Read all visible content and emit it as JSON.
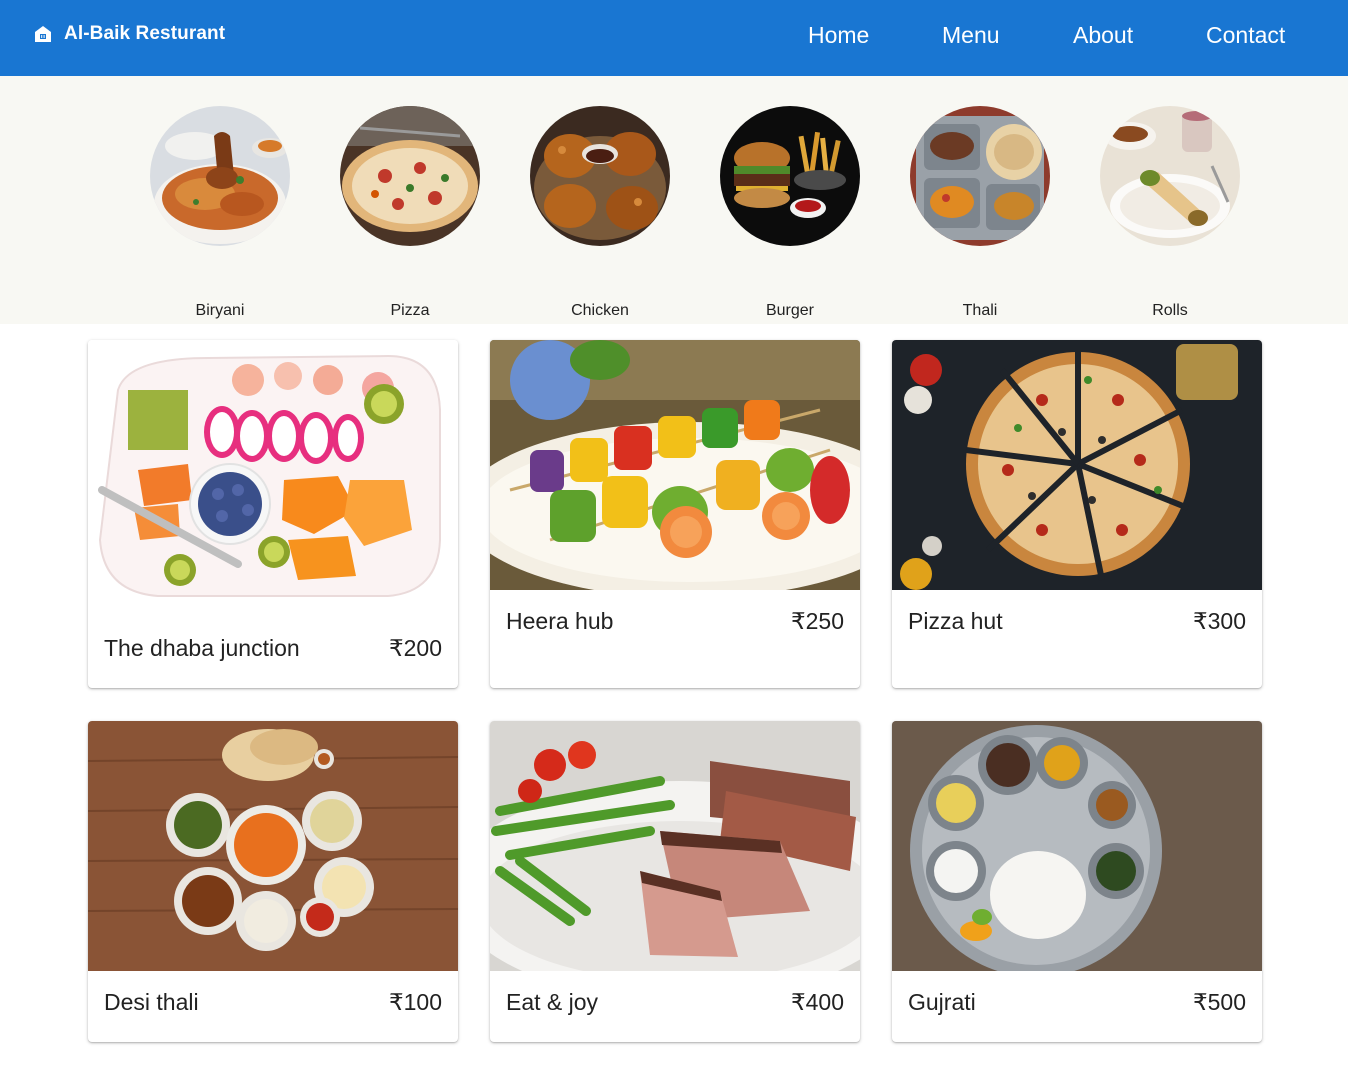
{
  "navbar": {
    "brand": "Al-Baik Resturant",
    "links": [
      "Home",
      "Menu",
      "About",
      "Contact"
    ]
  },
  "categories": [
    {
      "label": "Biryani",
      "icon": "biryani-image"
    },
    {
      "label": "Pizza",
      "icon": "pizza-image"
    },
    {
      "label": "Chicken",
      "icon": "chicken-image"
    },
    {
      "label": "Burger",
      "icon": "burger-image"
    },
    {
      "label": "Thali",
      "icon": "thali-image"
    },
    {
      "label": "Rolls",
      "icon": "rolls-image"
    }
  ],
  "restaurants": [
    {
      "name": "The dhaba junction",
      "price": "₹200"
    },
    {
      "name": "Heera hub",
      "price": "₹250"
    },
    {
      "name": "Pizza hut",
      "price": "₹300"
    },
    {
      "name": "Desi thali",
      "price": "₹100"
    },
    {
      "name": "Eat & joy",
      "price": "₹400"
    },
    {
      "name": "Gujrati",
      "price": "₹500"
    }
  ],
  "colors": {
    "primary": "#1976d2",
    "strip_background": "#f8f8f3"
  }
}
